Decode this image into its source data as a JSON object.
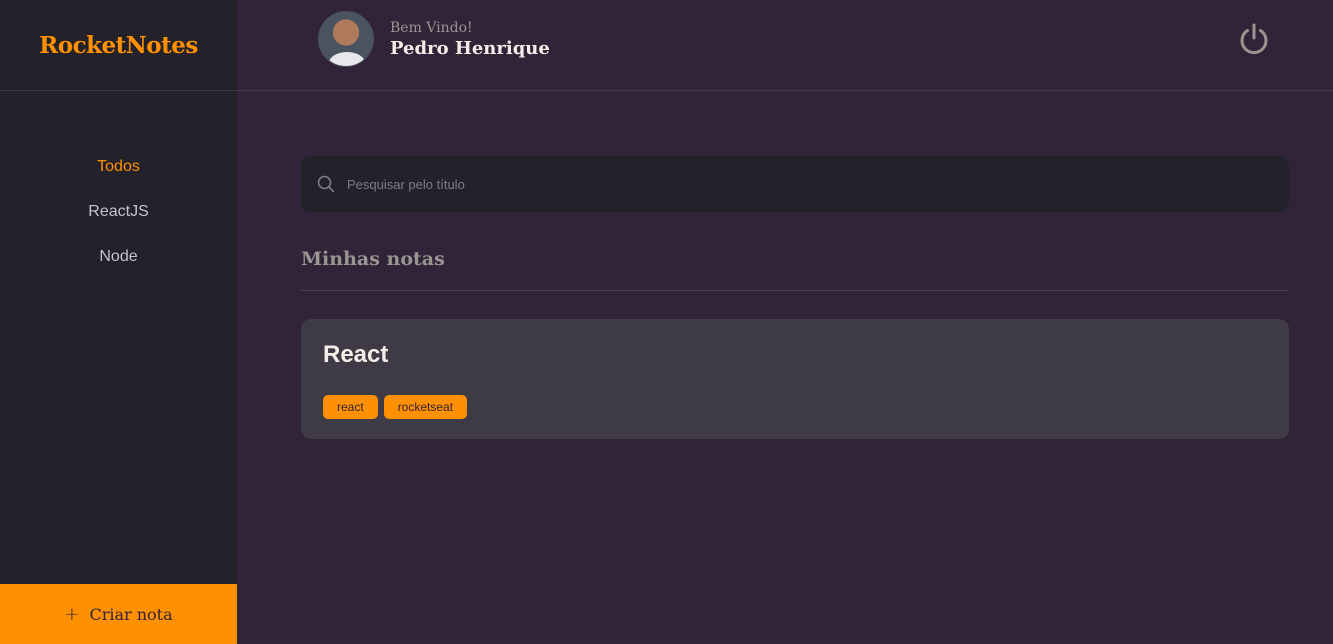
{
  "brand": "RocketNotes",
  "sidebar": {
    "items": [
      {
        "label": "Todos",
        "active": true
      },
      {
        "label": "ReactJS",
        "active": false
      },
      {
        "label": "Node",
        "active": false
      }
    ],
    "new_note_label": "Criar nota",
    "new_note_icon": "+"
  },
  "header": {
    "greeting": "Bem Vindo!",
    "user_name": "Pedro Henrique",
    "logout_icon": "power-icon"
  },
  "search": {
    "placeholder": "Pesquisar pelo título",
    "value": ""
  },
  "section": {
    "title": "Minhas notas"
  },
  "notes": [
    {
      "title": "React",
      "tags": [
        "react",
        "rocketseat"
      ]
    }
  ],
  "colors": {
    "accent": "#ff9000",
    "background": "#312438",
    "sidebar": "#232129",
    "card": "#3e3b47"
  }
}
